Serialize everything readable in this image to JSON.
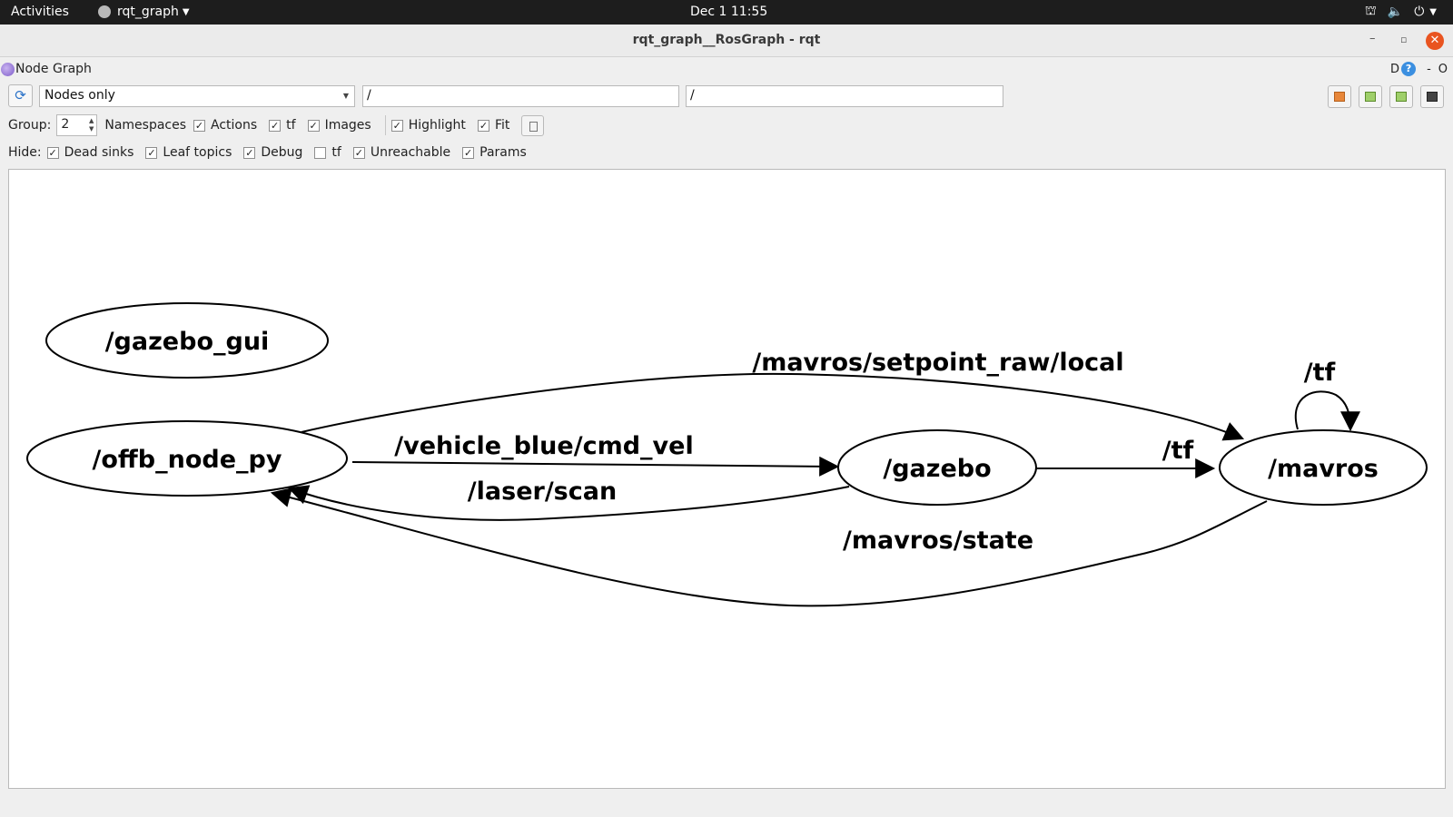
{
  "topbar": {
    "activities": "Activities",
    "app_name": "rqt_graph",
    "clock": "Dec 1  11:55",
    "tray_icons": [
      "network-icon",
      "volume-icon",
      "power-icon"
    ]
  },
  "window": {
    "title": "rqt_graph__RosGraph - rqt",
    "close_color": "#e95420"
  },
  "plugin": {
    "title": "Node Graph",
    "right_label_d": "D",
    "right_label_help": "?",
    "right_label_dash": "-",
    "right_label_o": "O"
  },
  "toolbar": {
    "mode": "Nodes only",
    "filter_include": "/",
    "filter_exclude": "/"
  },
  "group_row": {
    "group_label": "Group:",
    "group_value": "2",
    "namespaces_label": "Namespaces",
    "options": [
      {
        "label": "Actions",
        "checked": true
      },
      {
        "label": "tf",
        "checked": true
      },
      {
        "label": "Images",
        "checked": true
      },
      {
        "label": "Highlight",
        "checked": true
      },
      {
        "label": "Fit",
        "checked": true
      }
    ]
  },
  "hide_row": {
    "hide_label": "Hide:",
    "options": [
      {
        "label": "Dead sinks",
        "checked": true
      },
      {
        "label": "Leaf topics",
        "checked": true
      },
      {
        "label": "Debug",
        "checked": true
      },
      {
        "label": "tf",
        "checked": false
      },
      {
        "label": "Unreachable",
        "checked": true
      },
      {
        "label": "Params",
        "checked": true
      }
    ]
  },
  "graph": {
    "nodes": {
      "gazebo_gui": "/gazebo_gui",
      "offb_node_py": "/offb_node_py",
      "gazebo": "/gazebo",
      "mavros": "/mavros"
    },
    "edges": {
      "setpoint_raw": "/mavros/setpoint_raw/local",
      "cmd_vel": "/vehicle_blue/cmd_vel",
      "laser_scan": "/laser/scan",
      "tf_gazebo_mavros": "/tf",
      "tf_self": "/tf",
      "mavros_state": "/mavros/state"
    }
  }
}
